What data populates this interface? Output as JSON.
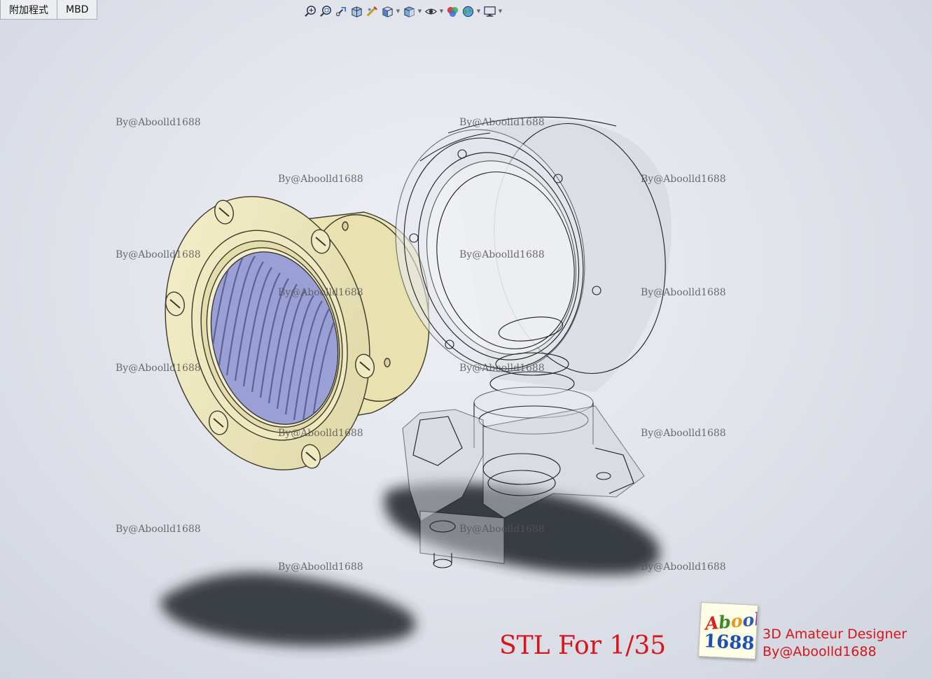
{
  "tabs": [
    {
      "label": "附加程式"
    },
    {
      "label": "MBD"
    }
  ],
  "hud_toolbar": {
    "icons": [
      {
        "name": "zoom-to-fit-icon"
      },
      {
        "name": "zoom-to-area-icon"
      },
      {
        "name": "previous-view-icon"
      },
      {
        "name": "section-view-icon"
      },
      {
        "name": "dynamic-annotation-icon"
      },
      {
        "name": "view-orientation-icon",
        "dropdown": true
      },
      {
        "name": "display-style-icon",
        "dropdown": true
      },
      {
        "name": "hide-show-items-icon",
        "dropdown": true
      },
      {
        "name": "edit-appearance-icon"
      },
      {
        "name": "apply-scene-icon",
        "dropdown": true
      },
      {
        "name": "view-settings-icon",
        "dropdown": true
      }
    ]
  },
  "watermark": "By@Aboolld1688",
  "caption": "STL For 1/35",
  "logo": {
    "line1": "Aboolld",
    "line2": "1688"
  },
  "credit": {
    "line1": "3D Amateur Designer",
    "line2": "By@Aboolld1688"
  },
  "colors": {
    "flange": "#ece6bc",
    "flange_edge": "#3a382a",
    "grille": "#9aa0d6",
    "glass": "#c9ccd3",
    "caption": "#d8141c"
  }
}
